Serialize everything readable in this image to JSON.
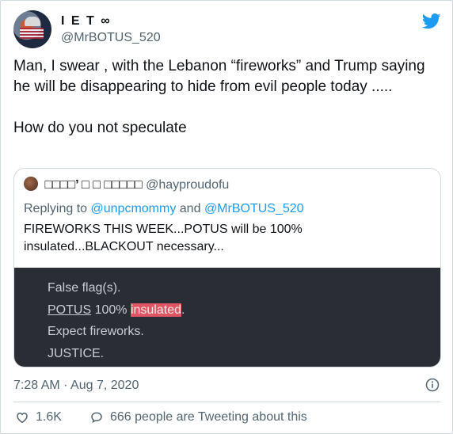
{
  "author": {
    "display_name": "I E T ∞",
    "handle": "@MrBOTUS_520"
  },
  "tweet": {
    "text": "Man, I swear , with the Lebanon  “fireworks”  and Trump saying he will be disappearing to hide from evil people today .....\n\nHow do you not speculate",
    "timestamp": "7:28 AM · Aug 7, 2020"
  },
  "quoted": {
    "display_name": "□□□□’ □ □ □□□□□",
    "handle": "@hayproudofu",
    "replying_prefix": "Replying to",
    "mention_1": "@unpcmommy",
    "and_word": "and",
    "mention_2": "@MrBOTUS_520",
    "text": "FIREWORKS THIS WEEK...POTUS will be 100% insulated...BLACKOUT necessary...",
    "image_lines": {
      "line1": "False flag(s).",
      "line2_word1": "POTUS",
      "line2_word2": "100%",
      "line2_highlight": "insulated",
      "line2_end": ".",
      "line3": "Expect fireworks.",
      "line4": "JUSTICE."
    }
  },
  "stats": {
    "likes": "1.6K",
    "tweeting": "666 people are Tweeting about this"
  },
  "colors": {
    "accent": "#1d9bf0",
    "text_secondary": "#536471",
    "highlight": "#e05564"
  },
  "icons": {
    "brand": "twitter-bird-icon",
    "info": "info-icon",
    "like": "heart-icon",
    "reply": "speech-bubble-icon"
  }
}
